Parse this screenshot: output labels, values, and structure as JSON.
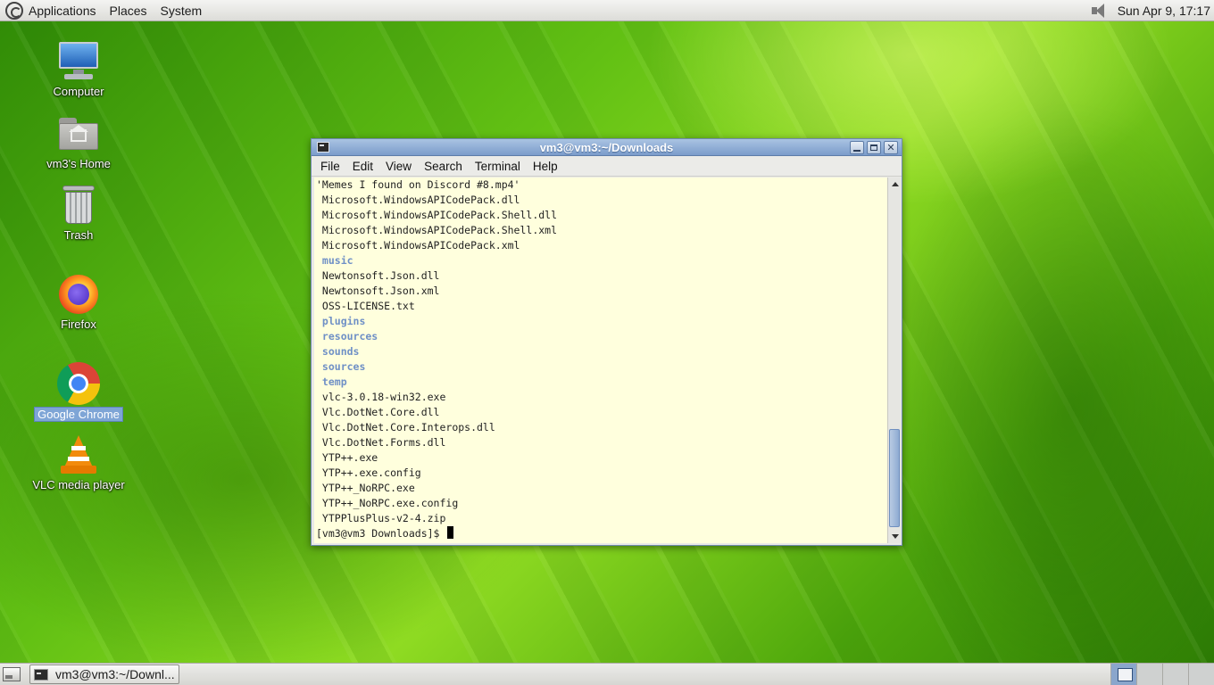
{
  "top_panel": {
    "menus": [
      "Applications",
      "Places",
      "System"
    ],
    "clock": "Sun Apr  9, 17:17",
    "icons": [
      "gnome-foot-icon",
      "volume-icon"
    ]
  },
  "desktop_icons": [
    {
      "label": "Computer",
      "icon": "computer-icon"
    },
    {
      "label": "vm3's Home",
      "icon": "home-folder-icon"
    },
    {
      "label": "Trash",
      "icon": "trash-icon"
    },
    {
      "label": "Firefox",
      "icon": "firefox-icon"
    },
    {
      "label": "Google Chrome",
      "icon": "chrome-icon",
      "selected": true
    },
    {
      "label": "VLC media player",
      "icon": "vlc-icon"
    }
  ],
  "terminal": {
    "title": "vm3@vm3:~/Downloads",
    "menu": [
      "File",
      "Edit",
      "View",
      "Search",
      "Terminal",
      "Help"
    ],
    "lines": [
      {
        "text": "'Memes I found on Discord #8.mp4'",
        "type": "file"
      },
      {
        "text": " Microsoft.WindowsAPICodePack.dll",
        "type": "file"
      },
      {
        "text": " Microsoft.WindowsAPICodePack.Shell.dll",
        "type": "file"
      },
      {
        "text": " Microsoft.WindowsAPICodePack.Shell.xml",
        "type": "file"
      },
      {
        "text": " Microsoft.WindowsAPICodePack.xml",
        "type": "file"
      },
      {
        "text": " music",
        "type": "dir"
      },
      {
        "text": " Newtonsoft.Json.dll",
        "type": "file"
      },
      {
        "text": " Newtonsoft.Json.xml",
        "type": "file"
      },
      {
        "text": " OSS-LICENSE.txt",
        "type": "file"
      },
      {
        "text": " plugins",
        "type": "dir"
      },
      {
        "text": " resources",
        "type": "dir"
      },
      {
        "text": " sounds",
        "type": "dir"
      },
      {
        "text": " sources",
        "type": "dir"
      },
      {
        "text": " temp",
        "type": "dir"
      },
      {
        "text": " vlc-3.0.18-win32.exe",
        "type": "file"
      },
      {
        "text": " Vlc.DotNet.Core.dll",
        "type": "file"
      },
      {
        "text": " Vlc.DotNet.Core.Interops.dll",
        "type": "file"
      },
      {
        "text": " Vlc.DotNet.Forms.dll",
        "type": "file"
      },
      {
        "text": " YTP++.exe",
        "type": "file"
      },
      {
        "text": " YTP++.exe.config",
        "type": "file"
      },
      {
        "text": " YTP++_NoRPC.exe",
        "type": "file"
      },
      {
        "text": " YTP++_NoRPC.exe.config",
        "type": "file"
      },
      {
        "text": " YTPPlusPlus-v2-4.zip",
        "type": "file"
      }
    ],
    "prompt": "[vm3@vm3 Downloads]$ "
  },
  "bottom_panel": {
    "task_label": "vm3@vm3:~/Downl...",
    "workspace_count": 4,
    "active_workspace": 1
  },
  "colors": {
    "terminal_bg": "#ffffdd",
    "dir_text": "#6f90c6",
    "titlebar": "#7b9ccb"
  }
}
